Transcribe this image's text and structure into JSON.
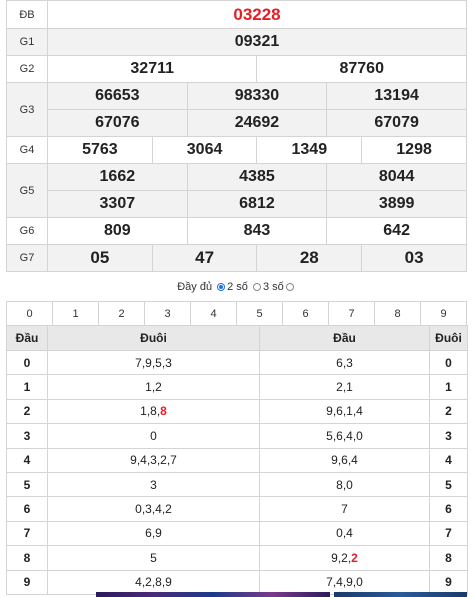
{
  "results": {
    "rows": [
      {
        "label": "ĐB",
        "nums": [
          "03228"
        ],
        "special": true
      },
      {
        "label": "G1",
        "nums": [
          "09321"
        ]
      },
      {
        "label": "G2",
        "nums": [
          "32711",
          "87760"
        ]
      },
      {
        "label": "G3",
        "nums": [
          "66653",
          "98330",
          "13194",
          "67076",
          "24692",
          "67079"
        ]
      },
      {
        "label": "G4",
        "nums": [
          "5763",
          "3064",
          "1349",
          "1298"
        ]
      },
      {
        "label": "G5",
        "nums": [
          "1662",
          "4385",
          "8044",
          "3307",
          "6812",
          "3899"
        ]
      },
      {
        "label": "G6",
        "nums": [
          "809",
          "843",
          "642"
        ]
      },
      {
        "label": "G7",
        "nums": [
          "05",
          "47",
          "28",
          "03"
        ]
      }
    ]
  },
  "options": {
    "full": "Đầy đủ",
    "two": "2 số",
    "three": "3 số",
    "selected": "two"
  },
  "digits": [
    "0",
    "1",
    "2",
    "3",
    "4",
    "5",
    "6",
    "7",
    "8",
    "9"
  ],
  "headtail": {
    "headers": [
      "Đầu",
      "Đuôi",
      "Đầu",
      "Đuôi"
    ],
    "rows": [
      {
        "k": "0",
        "a": "7,9,5,3",
        "b": "6,3",
        "k2": "0"
      },
      {
        "k": "1",
        "a": "1,2",
        "b": "2,1",
        "k2": "1"
      },
      {
        "k": "2",
        "a_plain": "1,8,",
        "a_red": "8",
        "b": "9,6,1,4",
        "k2": "2"
      },
      {
        "k": "3",
        "a": "0",
        "b": "5,6,4,0",
        "k2": "3"
      },
      {
        "k": "4",
        "a": "9,4,3,2,7",
        "b": "9,6,4",
        "k2": "4"
      },
      {
        "k": "5",
        "a": "3",
        "b": "8,0",
        "k2": "5"
      },
      {
        "k": "6",
        "a": "0,3,4,2",
        "b": "7",
        "k2": "6"
      },
      {
        "k": "7",
        "a": "6,9",
        "b": "0,4",
        "k2": "7"
      },
      {
        "k": "8",
        "a": "5",
        "b_plain": "9,2,",
        "b_red": "2",
        "k2": "8"
      },
      {
        "k": "9",
        "a": "4,2,8,9",
        "b": "7,4,9,0",
        "k2": "9"
      }
    ]
  }
}
